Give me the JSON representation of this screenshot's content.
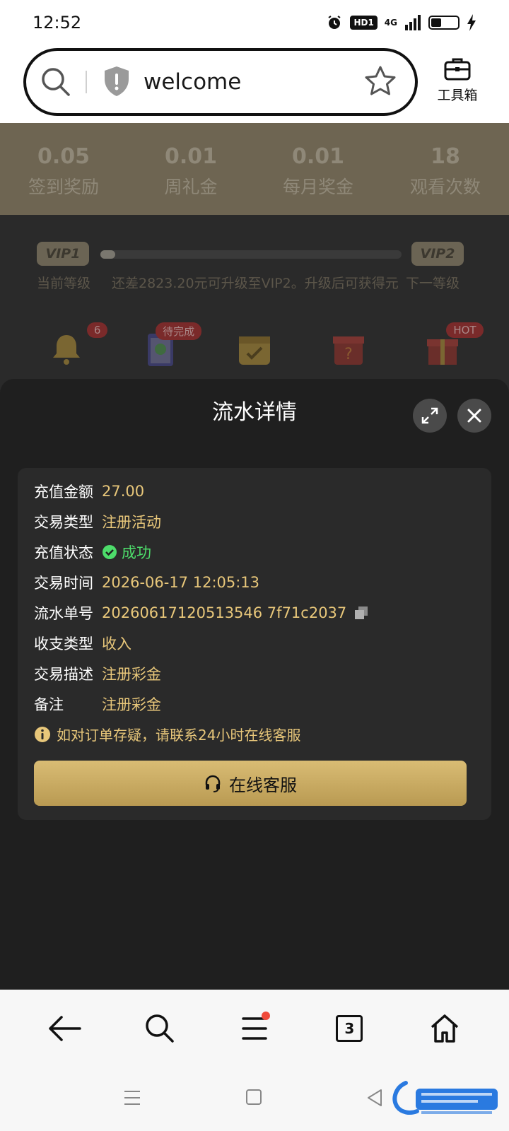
{
  "status_bar": {
    "time": "12:52",
    "hd_label": "HD1",
    "network": "4G"
  },
  "browser": {
    "url_text": "welcome",
    "toolbox_label": "工具箱"
  },
  "background": {
    "stats": [
      {
        "value": "0.05",
        "label": "签到奖励"
      },
      {
        "value": "0.01",
        "label": "周礼金"
      },
      {
        "value": "0.01",
        "label": "每月奖金"
      },
      {
        "value": "18",
        "label": "观看次数"
      }
    ],
    "vip": {
      "current_badge": "VIP1",
      "next_badge": "VIP2",
      "progress": 0.05,
      "current_label": "当前等级",
      "upgrade_text": "还差2823.20元可升级至VIP2。升级后可获得元",
      "next_label": "下一等级"
    },
    "icons": [
      {
        "name": "bell-icon",
        "badge": "6"
      },
      {
        "name": "task-icon",
        "badge": "待完成"
      },
      {
        "name": "calendar-icon",
        "badge": ""
      },
      {
        "name": "mystery-box-icon",
        "badge": ""
      },
      {
        "name": "gift-icon",
        "badge": "HOT"
      }
    ]
  },
  "modal": {
    "title": "流水详情",
    "rows": [
      {
        "label": "充值金额",
        "value": "27.00"
      },
      {
        "label": "交易类型",
        "value": "注册活动"
      },
      {
        "label": "充值状态",
        "value": "成功"
      },
      {
        "label": "交易时间",
        "value": "2026-06-17 12:05:13"
      },
      {
        "label": "流水单号",
        "value": "20260617120513546 7f71c2037"
      },
      {
        "label": "收支类型",
        "value": "收入"
      },
      {
        "label": "交易描述",
        "value": "注册彩金"
      },
      {
        "label": "备注",
        "value": "注册彩金"
      }
    ],
    "notice": "如对订单存疑，请联系24小时在线客服",
    "service_button": "在线客服"
  },
  "bottom_nav": {
    "tab_count": "3"
  },
  "colors": {
    "accent_gold": "#e8c77a",
    "success_green": "#4ddc6a",
    "button_gold": "#c8a960"
  }
}
